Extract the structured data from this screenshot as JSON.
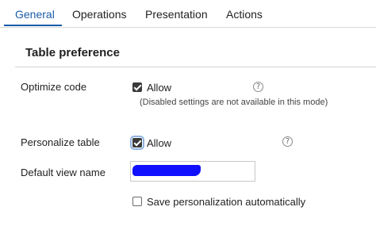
{
  "tabs": [
    {
      "label": "General",
      "active": true
    },
    {
      "label": "Operations",
      "active": false
    },
    {
      "label": "Presentation",
      "active": false
    },
    {
      "label": "Actions",
      "active": false
    }
  ],
  "section": {
    "title": "Table preference"
  },
  "optimize_code": {
    "label": "Optimize code",
    "checkbox_label": "Allow",
    "checked": true,
    "hint": "(Disabled settings are not available in this mode)",
    "help_icon": "question-circle-icon"
  },
  "personalize_table": {
    "label": "Personalize table",
    "checkbox_label": "Allow",
    "checked": true,
    "help_icon": "question-circle-icon"
  },
  "default_view_name": {
    "label": "Default view name",
    "value_redacted": true
  },
  "save_personalization": {
    "checkbox_label": "Save personalization automatically",
    "checked": false
  },
  "colors": {
    "accent": "#1a5ca8",
    "redaction": "#1010ff"
  }
}
